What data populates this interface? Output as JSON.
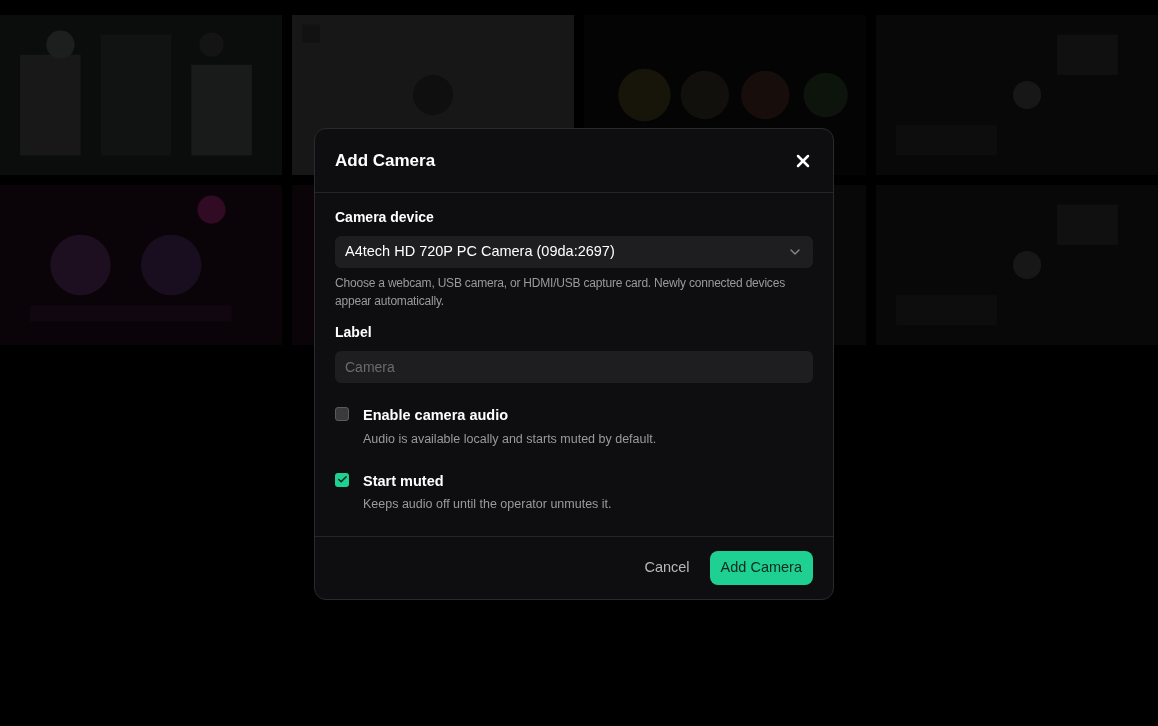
{
  "dialog": {
    "title": "Add Camera",
    "fields": [
      {
        "kind": "select",
        "label": "Camera device",
        "value": "A4tech HD 720P PC Camera (09da:2697)",
        "help": "Choose a webcam, USB camera, or HDMI/USB capture card. Newly connected devices appear automatically."
      },
      {
        "kind": "text",
        "label": "Label",
        "placeholder": "Camera"
      }
    ],
    "options": [
      {
        "label": "Enable camera audio",
        "description": "Audio is available locally and starts muted by default.",
        "checked": false
      },
      {
        "label": "Start muted",
        "description": "Keeps audio off until the operator unmutes it.",
        "checked": true
      }
    ],
    "buttons": [
      {
        "kind": "secondary",
        "label": "Cancel"
      },
      {
        "kind": "primary",
        "label": "Add Camera"
      }
    ]
  }
}
